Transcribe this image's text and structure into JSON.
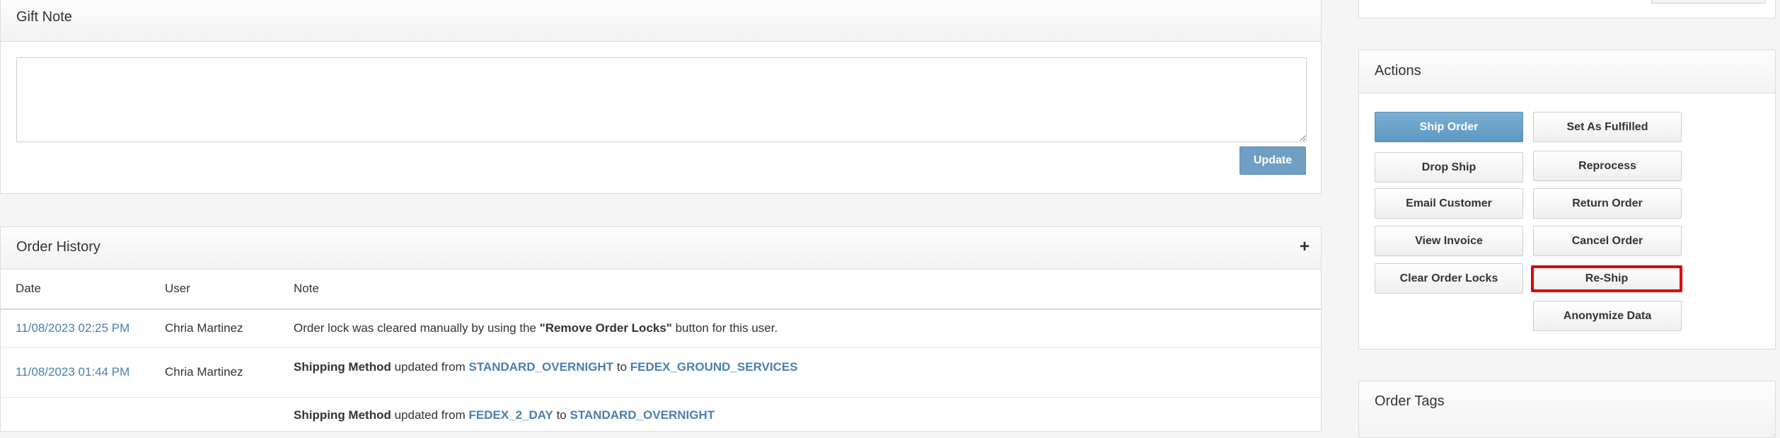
{
  "gift_note": {
    "title": "Gift Note",
    "textarea_value": "",
    "update_label": "Update"
  },
  "order_history": {
    "title": "Order History",
    "expand_icon": "plus-icon",
    "columns": [
      "Date",
      "User",
      "Note"
    ],
    "rows": [
      {
        "date": "11/08/2023 02:25 PM",
        "user": "Chria Martinez",
        "note_pre": "Order lock was cleared manually by using the ",
        "note_bold": "\"Remove Order Locks\"",
        "note_post": " button for this user."
      },
      {
        "date": "11/08/2023 01:44 PM",
        "user": "Chria Martinez",
        "field": "Shipping Method",
        "mid": " updated from ",
        "from": "STANDARD_OVERNIGHT",
        "to_word": " to ",
        "to": "FEDEX_GROUND_SERVICES"
      },
      {
        "date": "",
        "user": "",
        "field": "Shipping Method",
        "mid": " updated from ",
        "from": "FEDEX_2_DAY",
        "to_word": " to ",
        "to": "STANDARD_OVERNIGHT"
      }
    ]
  },
  "actions": {
    "title": "Actions",
    "buttons": {
      "ship_order": "Ship Order",
      "set_as_fulfilled": "Set As Fulfilled",
      "drop_ship": "Drop Ship",
      "reprocess": "Reprocess",
      "email_customer": "Email Customer",
      "return_order": "Return Order",
      "view_invoice": "View Invoice",
      "cancel_order": "Cancel Order",
      "clear_order_locks": "Clear Order Locks",
      "re_ship": "Re-Ship",
      "anonymize_data": "Anonymize Data"
    },
    "highlight_color": "#e00000",
    "primary_color": "#6fa5cc"
  },
  "order_tags": {
    "title": "Order Tags"
  }
}
